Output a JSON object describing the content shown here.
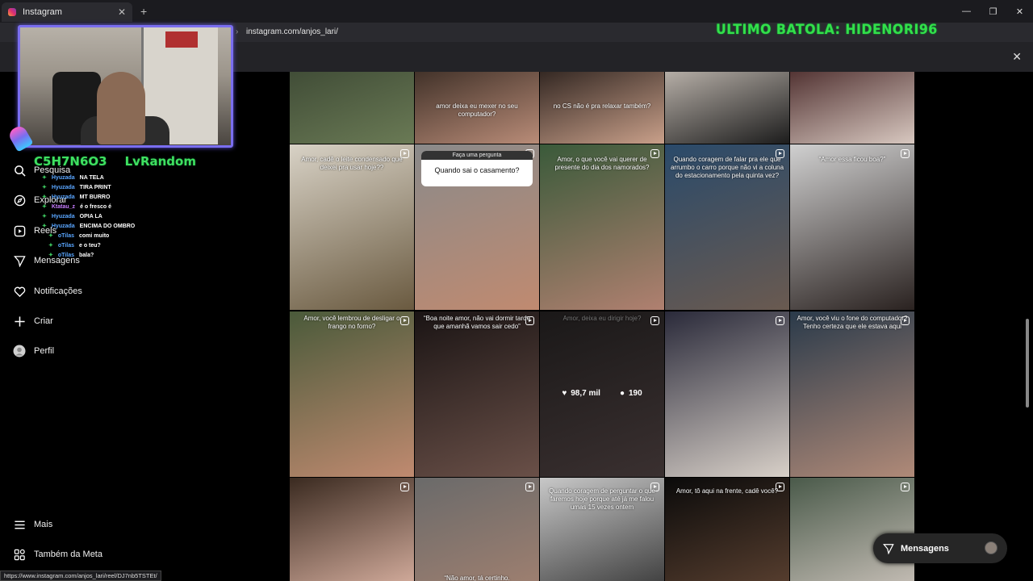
{
  "browser": {
    "tab_title": "Instagram",
    "new_tab": "+",
    "url": "instagram.com/anjos_lari/",
    "status_url": "https://www.instagram.com/anjos_lari/reel/DJ7nb5TSTEt/"
  },
  "stream_overlay": {
    "top_banner": "ULTIMO BATOLA: HIDENORI96",
    "names": [
      "C5H7N6O3",
      "LvRandom"
    ],
    "chat": [
      {
        "user": "Hyuzada",
        "msg": "NA TELA"
      },
      {
        "user": "Hyuzada",
        "msg": "TIRA PRINT"
      },
      {
        "user": "Hyuzada",
        "msg": "MT BURRO"
      },
      {
        "user": "Ktatau_z",
        "msg": "é o fresco é"
      },
      {
        "user": "Hyuzada",
        "msg": "OPIA LA"
      },
      {
        "user": "Hyuzada",
        "msg": "ENCIMA DO OMBRO"
      },
      {
        "user": "oTilas",
        "msg": "comi muito"
      },
      {
        "user": "oTilas",
        "msg": "e o teu?"
      },
      {
        "user": "oTilas",
        "msg": "bala?"
      }
    ]
  },
  "sidebar": {
    "items": [
      {
        "label": "Pesquisa",
        "icon": "search-icon"
      },
      {
        "label": "Explorar",
        "icon": "compass-icon"
      },
      {
        "label": "Reels",
        "icon": "reels-icon"
      },
      {
        "label": "Mensagens",
        "icon": "send-icon"
      },
      {
        "label": "Notificações",
        "icon": "heart-icon"
      },
      {
        "label": "Criar",
        "icon": "plus-icon"
      },
      {
        "label": "Perfil",
        "icon": "avatar-icon"
      }
    ],
    "bottom": [
      {
        "label": "Mais",
        "icon": "menu-icon"
      },
      {
        "label": "Também da Meta",
        "icon": "meta-icon"
      }
    ]
  },
  "grid": {
    "rows": [
      [
        {
          "caption": "",
          "reel": false,
          "colors": [
            "#3e4a35",
            "#6a7a55"
          ]
        },
        {
          "caption": "amor deixa eu mexer no seu computador?",
          "reel": false,
          "colors": [
            "#3a2c24",
            "#b98c78"
          ]
        },
        {
          "caption": "no CS não é pra relaxar também?",
          "reel": false,
          "colors": [
            "#2a201c",
            "#c9a08a"
          ]
        },
        {
          "caption": "",
          "reel": false,
          "colors": [
            "#c0b8b0",
            "#1c1c1c"
          ]
        },
        {
          "caption": "",
          "reel": false,
          "colors": [
            "#4a2a2a",
            "#d8c8c0"
          ]
        }
      ],
      [
        {
          "caption": "Amor, cadê o leite condensado que deixei pra usar hoje??",
          "reel": true,
          "colors": [
            "#d8d2c6",
            "#6a5a40"
          ]
        },
        {
          "caption": "",
          "reel": true,
          "question": {
            "header": "Faça uma pergunta",
            "text": "Quando sai o casamento?"
          },
          "colors": [
            "#8a8a8a",
            "#c08a70"
          ]
        },
        {
          "caption": "Amor, o que você vai querer de presente do dia dos namorados?",
          "reel": true,
          "colors": [
            "#3a5a3a",
            "#b08070"
          ]
        },
        {
          "caption": "Quando coragem de falar pra ele que arrumbo o carro porque não vi a coluna do estacionamento pela quinta vez?",
          "reel": true,
          "colors": [
            "#2a4a6a",
            "#6a5a50"
          ]
        },
        {
          "caption": "“Amor essa ficou boa?”",
          "reel": true,
          "colors": [
            "#d0d0d0",
            "#2a2220"
          ]
        }
      ],
      [
        {
          "caption": "Amor, você lembrou de desligar o frango no forno?",
          "reel": true,
          "colors": [
            "#4a5a3a",
            "#c08a70"
          ]
        },
        {
          "caption": "“Boa noite amor, não vai dormir tarde que amanhã vamos sair cedo”",
          "reel": true,
          "colors": [
            "#1a1414",
            "#6a5048"
          ]
        },
        {
          "caption": "Amor, deixa eu dirigir hoje?",
          "reel": true,
          "stats": {
            "likes": "98,7 mil",
            "comments": "190"
          },
          "colors": [
            "#1a1818",
            "#3a3030"
          ]
        },
        {
          "caption": "",
          "reel": true,
          "colors": [
            "#2a2a3a",
            "#d8d0c8"
          ]
        },
        {
          "caption": "Amor, você viu o fone do computador? Tenho certeza que ele estava aqui",
          "reel": true,
          "colors": [
            "#2a3a4a",
            "#b08a78"
          ]
        }
      ],
      [
        {
          "caption": "",
          "reel": true,
          "colors": [
            "#3a2a20",
            "#d8b0a0"
          ]
        },
        {
          "caption": "“Não amor, tá certinho.",
          "reel": true,
          "colors": [
            "#6a6a6a",
            "#a08070"
          ]
        },
        {
          "caption": "Quando coragem de perguntar o que faremos hoje porque até já me falou umas 15 vezes ontem",
          "reel": true,
          "colors": [
            "#c8c8c8",
            "#3a3a3a"
          ]
        },
        {
          "caption": "Amor, tô aqui na frente, cadê você?",
          "reel": true,
          "colors": [
            "#0a0a0a",
            "#5a4030"
          ]
        },
        {
          "caption": "",
          "reel": true,
          "colors": [
            "#4a5a4a",
            "#c8c0b8"
          ]
        }
      ]
    ]
  },
  "messages_button": {
    "label": "Mensagens"
  }
}
